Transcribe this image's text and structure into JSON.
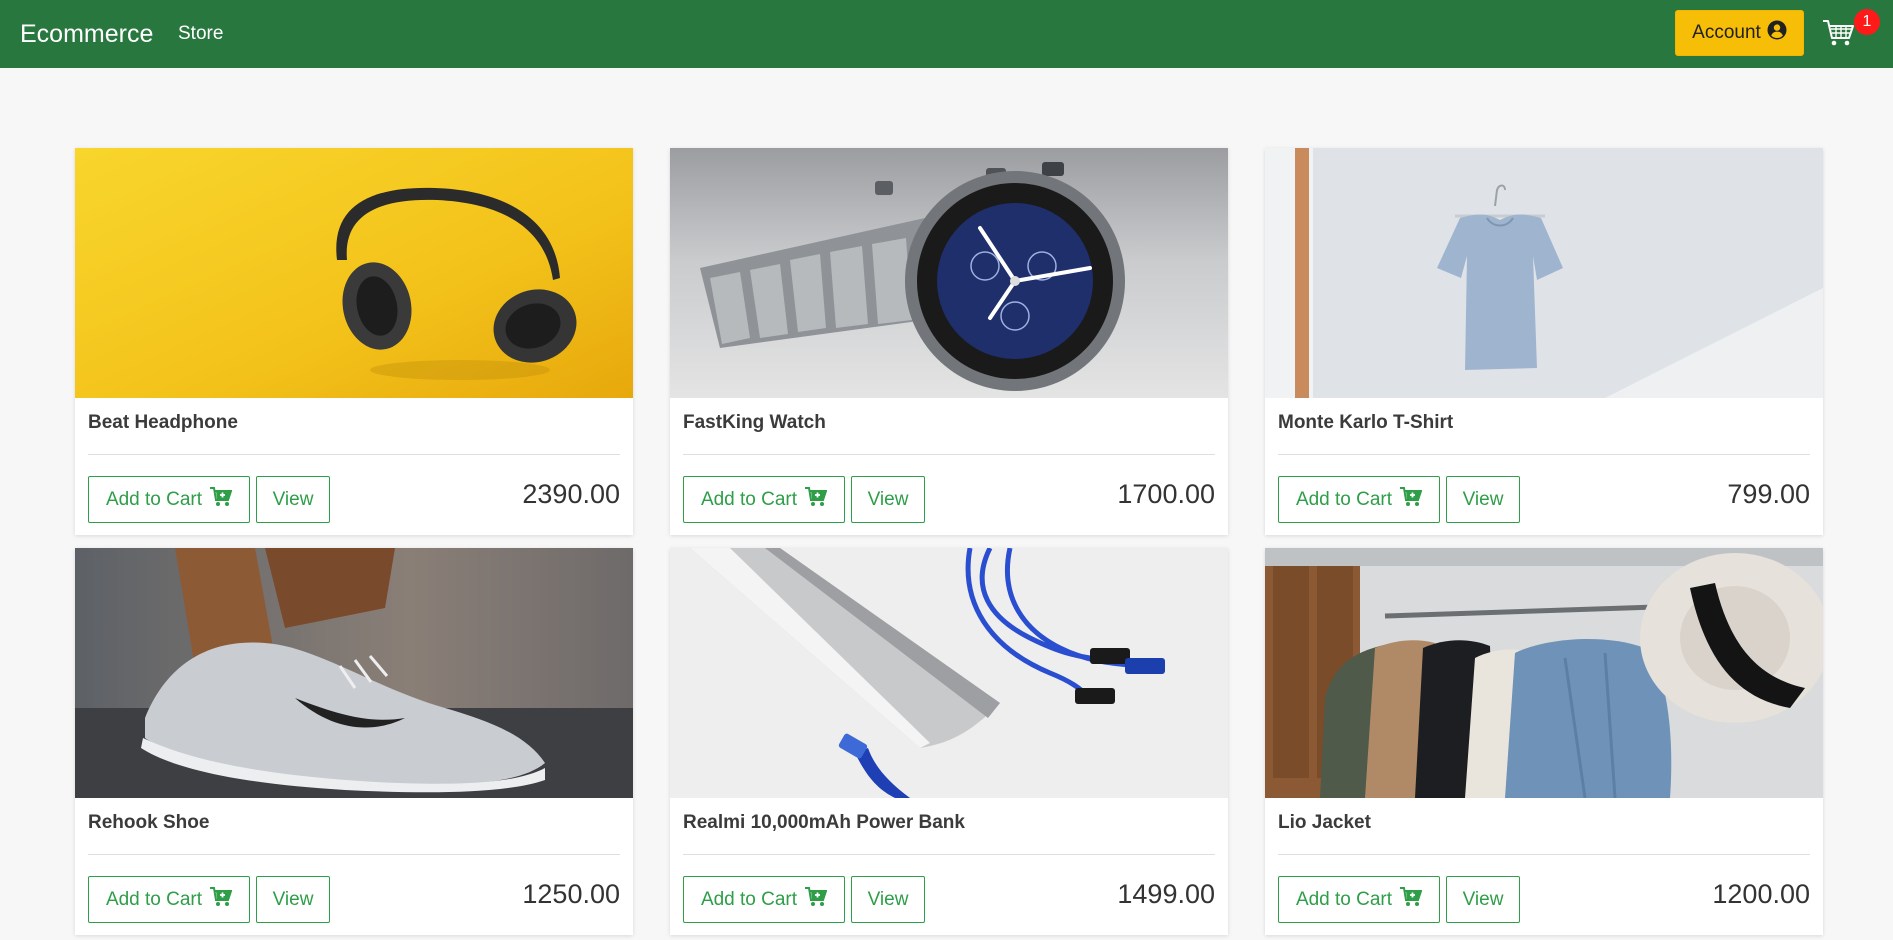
{
  "navbar": {
    "brand": "Ecommerce",
    "store_link": "Store",
    "account_label": "Account",
    "account_icon": "user-circle-icon",
    "cart_icon": "shopping-cart-icon",
    "cart_count": "1",
    "colors": {
      "background": "#28773f",
      "account_button": "#f7be07",
      "badge": "#ff1a1a"
    }
  },
  "products": [
    {
      "name": "Beat Headphone",
      "add_label": "Add to Cart",
      "view_label": "View",
      "price": "2390.00",
      "image": "headphones-on-yellow"
    },
    {
      "name": "FastKing Watch",
      "add_label": "Add to Cart",
      "view_label": "View",
      "price": "1700.00",
      "image": "chronograph-watch"
    },
    {
      "name": "Monte Karlo T-Shirt",
      "add_label": "Add to Cart",
      "view_label": "View",
      "price": "799.00",
      "image": "t-shirt-on-hanger"
    },
    {
      "name": "Rehook Shoe",
      "add_label": "Add to Cart",
      "view_label": "View",
      "price": "1250.00",
      "image": "sneaker-on-asphalt"
    },
    {
      "name": "Realmi 10,000mAh Power Bank",
      "add_label": "Add to Cart",
      "view_label": "View",
      "price": "1499.00",
      "image": "power-bank-and-cables"
    },
    {
      "name": "Lio Jacket",
      "add_label": "Add to Cart",
      "view_label": "View",
      "price": "1200.00",
      "image": "jackets-and-hat-on-rack"
    }
  ],
  "accent_color": "#2e9e48"
}
